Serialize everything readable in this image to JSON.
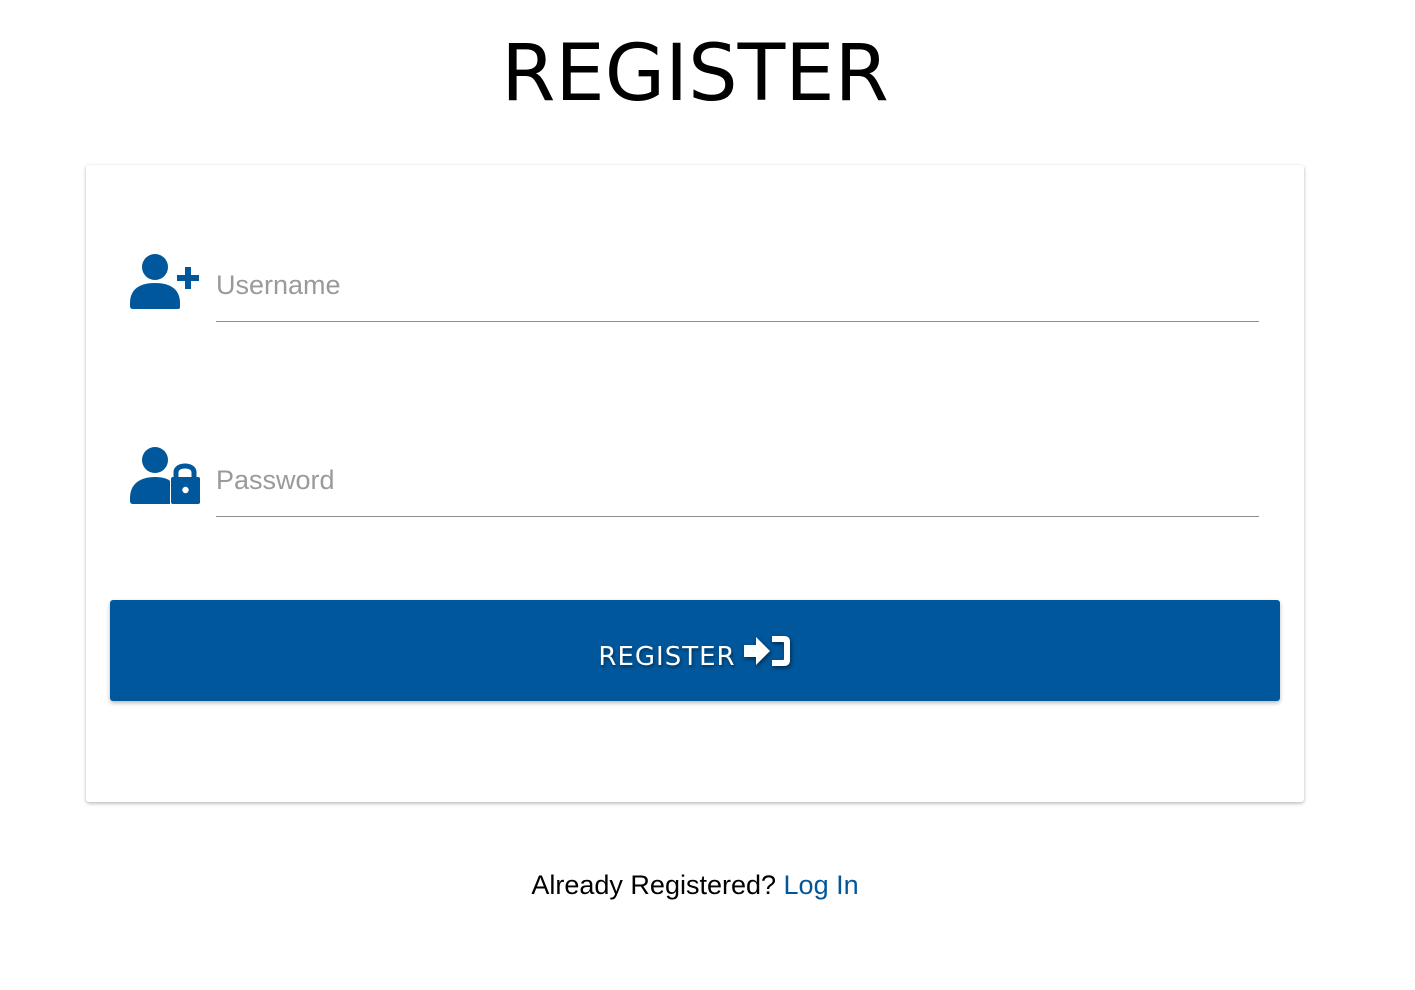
{
  "header": {
    "title": "REGISTER"
  },
  "form": {
    "username": {
      "icon": "user-plus-icon",
      "placeholder": "Username",
      "value": ""
    },
    "password": {
      "icon": "user-lock-icon",
      "placeholder": "Password",
      "value": ""
    },
    "submit": {
      "label": "REGISTER",
      "icon": "sign-in-icon"
    }
  },
  "footer": {
    "prompt": "Already Registered?",
    "link_label": "Log In"
  },
  "colors": {
    "primary": "#01579b",
    "underline": "#8e8e8e",
    "placeholder": "#9a9a9a",
    "background": "#ffffff"
  }
}
